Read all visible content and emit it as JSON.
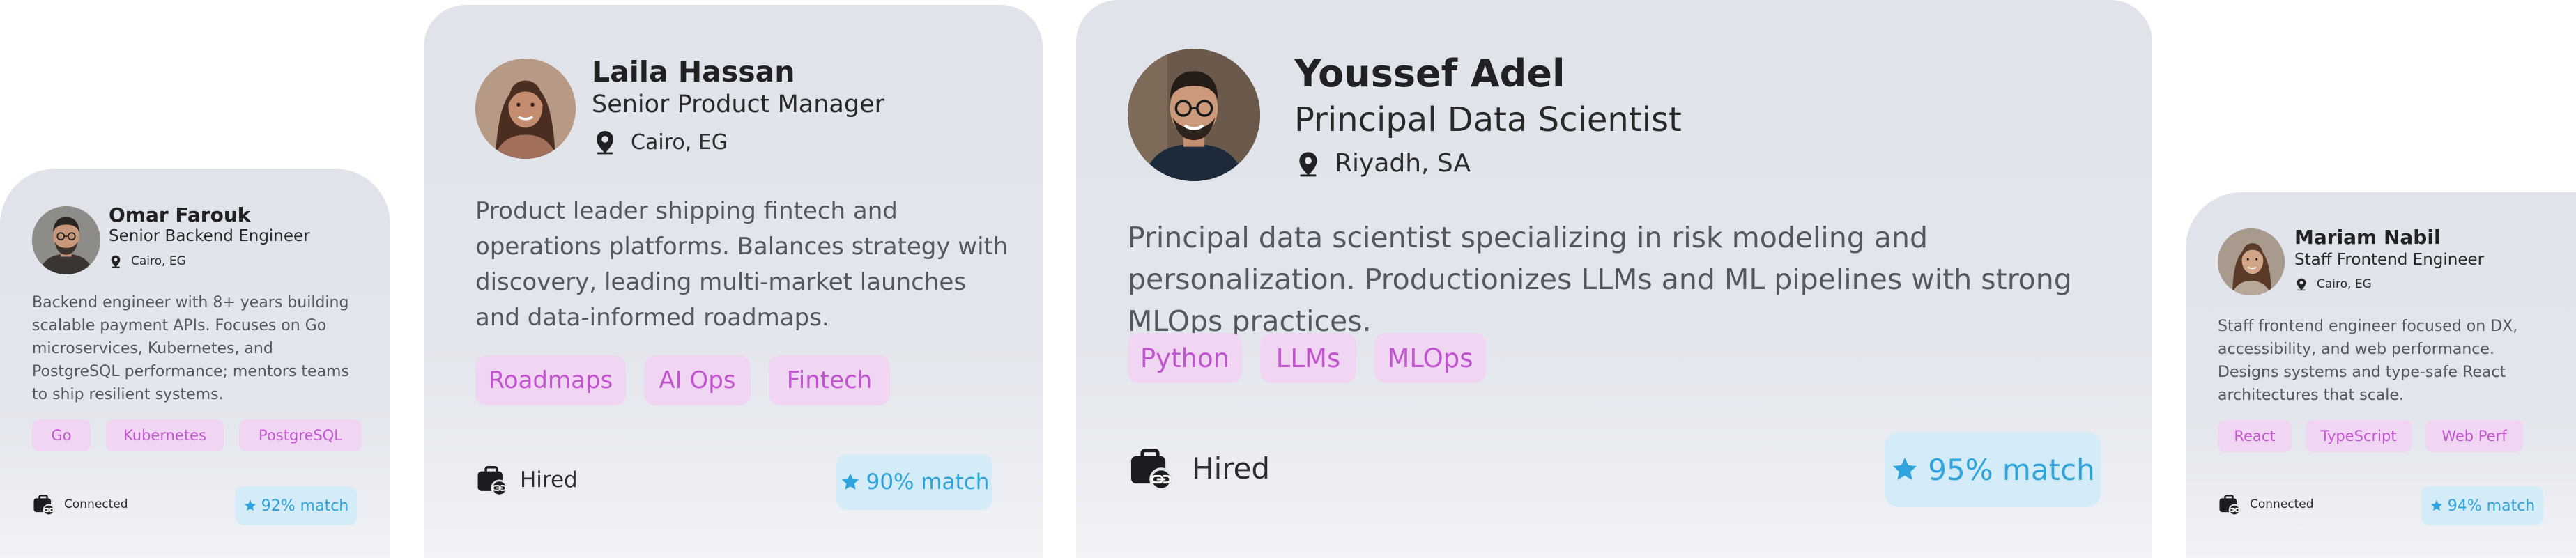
{
  "cards": [
    {
      "name": "Omar Farouk",
      "title": "Senior Backend Engineer",
      "location": "Cairo, EG",
      "bio": "Backend engineer with 8+ years building scalable payment APIs. Focuses on Go microservices, Kubernetes, and PostgreSQL performance; mentors teams to ship resilient systems.",
      "skills": [
        "Go",
        "Kubernetes",
        "PostgreSQL"
      ],
      "status": "Connected",
      "status_icon": "briefcase-link-icon",
      "match": "92% match",
      "match_icon": "star-icon"
    },
    {
      "name": "Laila Hassan",
      "title": "Senior Product Manager",
      "location": "Cairo, EG",
      "bio": "Product leader shipping fintech and operations platforms. Balances strategy with discovery, leading multi-market launches and data-informed roadmaps.",
      "skills": [
        "Roadmaps",
        "AI Ops",
        "Fintech"
      ],
      "status": "Hired",
      "status_icon": "briefcase-link-icon",
      "match": "90% match",
      "match_icon": "star-icon"
    },
    {
      "name": "Youssef Adel",
      "title": "Principal Data Scientist",
      "location": "Riyadh, SA",
      "bio": "Principal data scientist specializing in risk modeling and personalization. Productionizes LLMs and ML pipelines with strong MLOps practices.",
      "skills": [
        "Python",
        "LLMs",
        "MLOps"
      ],
      "status": "Hired",
      "status_icon": "briefcase-link-icon",
      "match": "95% match",
      "match_icon": "star-icon"
    },
    {
      "name": "Mariam Nabil",
      "title": "Staff Frontend Engineer",
      "location": "Cairo, EG",
      "bio": "Staff frontend engineer focused on DX, accessibility, and web performance. Designs systems and type-safe React architectures that scale.",
      "skills": [
        "React",
        "TypeScript",
        "Web Perf"
      ],
      "status": "Connected",
      "status_icon": "briefcase-link-icon",
      "match": "94% match",
      "match_icon": "star-icon"
    }
  ],
  "colors": {
    "tag_bg": "#f1d6f3",
    "tag_text": "#c154cf",
    "match_bg": "#d3ecf8",
    "match_text": "#2ea3dc",
    "card_bg": "#e1e4ea"
  }
}
